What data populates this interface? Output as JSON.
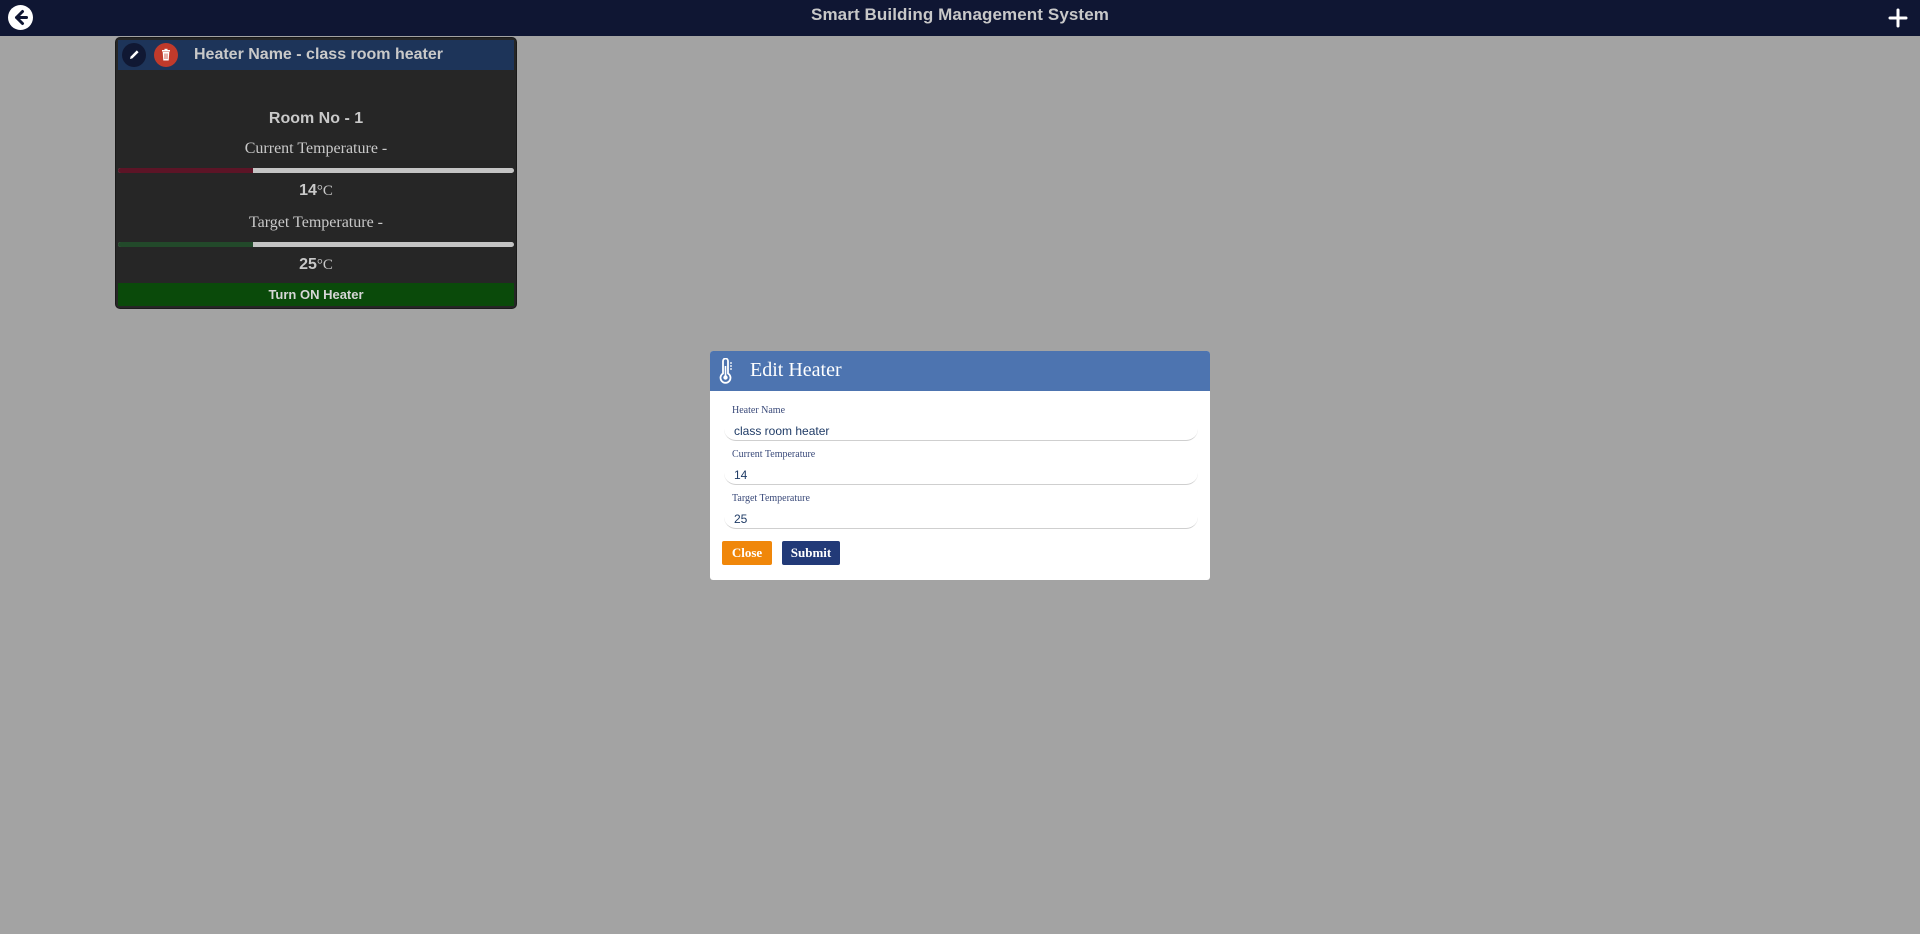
{
  "app": {
    "title": "Smart Building Management System"
  },
  "icons": {
    "back": "arrow-left-circle-icon",
    "add": "plus-icon",
    "edit": "pencil-icon",
    "delete": "trash-icon",
    "dialog": "thermometer-icon"
  },
  "colors": {
    "topbar": "#0f1633",
    "card_header": "#1d3459",
    "dialog_header": "#4d74b0",
    "turn_on": "#0a4a0a",
    "close": "#f0870a",
    "submit": "#223a78"
  },
  "heater_card": {
    "title": "Heater Name - class room heater",
    "room": "Room No - 1",
    "current_label": "Current Temperature -",
    "current_value": "14",
    "current_level": 0.34,
    "target_label": "Target Temperature -",
    "target_value": "25",
    "target_level": 0.34,
    "unit": "°C",
    "toggle_label": "Turn ON Heater"
  },
  "dialog": {
    "title": "Edit Heater",
    "fields": [
      {
        "label": "Heater Name",
        "value": "class room heater"
      },
      {
        "label": "Current Temperature",
        "value": "14"
      },
      {
        "label": "Target Temperature",
        "value": "25"
      }
    ],
    "close_label": "Close",
    "submit_label": "Submit"
  }
}
